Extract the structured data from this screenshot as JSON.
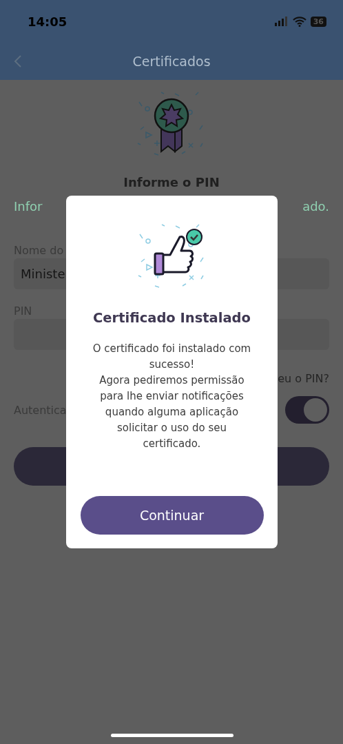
{
  "status_bar": {
    "time": "14:05",
    "battery": "36"
  },
  "nav": {
    "title": "Certificados"
  },
  "background": {
    "heading": "Informe o PIN",
    "subtitle_left": "Infor",
    "subtitle_right": "ado.",
    "name_label": "Nome do",
    "name_value": "Ministe",
    "pin_label": "PIN",
    "forgot_link": "eu o PIN?",
    "auth_label": "Autentica",
    "auth_toggle": {
      "on": true
    }
  },
  "dialog": {
    "title": "Certificado Instalado",
    "message": "O certificado foi instalado com sucesso!\nAgora pediremos permissão para lhe enviar notificações quando alguma aplicação solicitar o uso do seu certificado.",
    "button": "Continuar"
  }
}
